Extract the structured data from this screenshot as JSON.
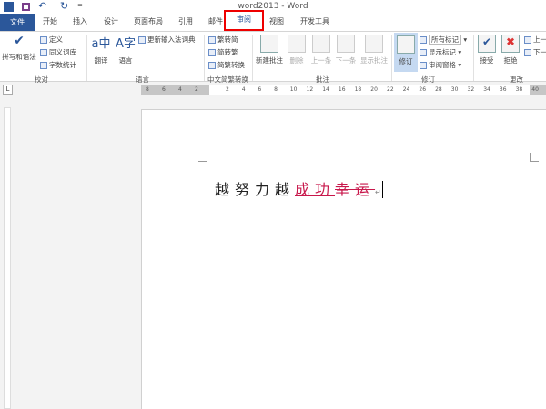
{
  "window": {
    "title": "word2013 - Word"
  },
  "qat": {
    "undo": "↶",
    "redo": "↻",
    "more": "="
  },
  "tabs": [
    "文件",
    "开始",
    "插入",
    "设计",
    "页面布局",
    "引用",
    "邮件",
    "审阅",
    "视图",
    "开发工具"
  ],
  "ribbon": {
    "proofing": {
      "label": "校对",
      "spell": "拼写和语法",
      "define": "定义",
      "thesaurus": "同义词库",
      "wordcount": "字数统计"
    },
    "language": {
      "label": "语言",
      "translate": "翻译",
      "language": "语言",
      "ime": "更新输入法词典"
    },
    "chinese": {
      "label": "中文简繁转换",
      "t2s": "繁转简",
      "s2t": "简转繁",
      "convert": "简繁转换"
    },
    "comments": {
      "label": "批注",
      "new": "新建批注",
      "delete": "删除",
      "prev": "上一条",
      "next": "下一条",
      "show": "显示批注"
    },
    "tracking": {
      "label": "修订",
      "track": "修订",
      "markup_select": "所有标记",
      "show_markup": "显示标记",
      "pane": "审阅窗格"
    },
    "changes": {
      "label": "更改",
      "accept": "接受",
      "reject": "拒绝",
      "prev": "上一",
      "next": "下一"
    }
  },
  "ruler": {
    "left": [
      "8",
      "6",
      "4",
      "2"
    ],
    "right": [
      "2",
      "4",
      "6",
      "8",
      "10",
      "12",
      "14",
      "16",
      "18",
      "20",
      "22",
      "24",
      "26",
      "28",
      "30",
      "32",
      "34",
      "36",
      "38",
      "40"
    ]
  },
  "document": {
    "normal": "越努力越",
    "inserted": "成功",
    "deleted": "幸运",
    "mark": "↵"
  },
  "colors": {
    "accent": "#2b579a",
    "revision": "#c8174b",
    "highlight": "#e00000"
  }
}
